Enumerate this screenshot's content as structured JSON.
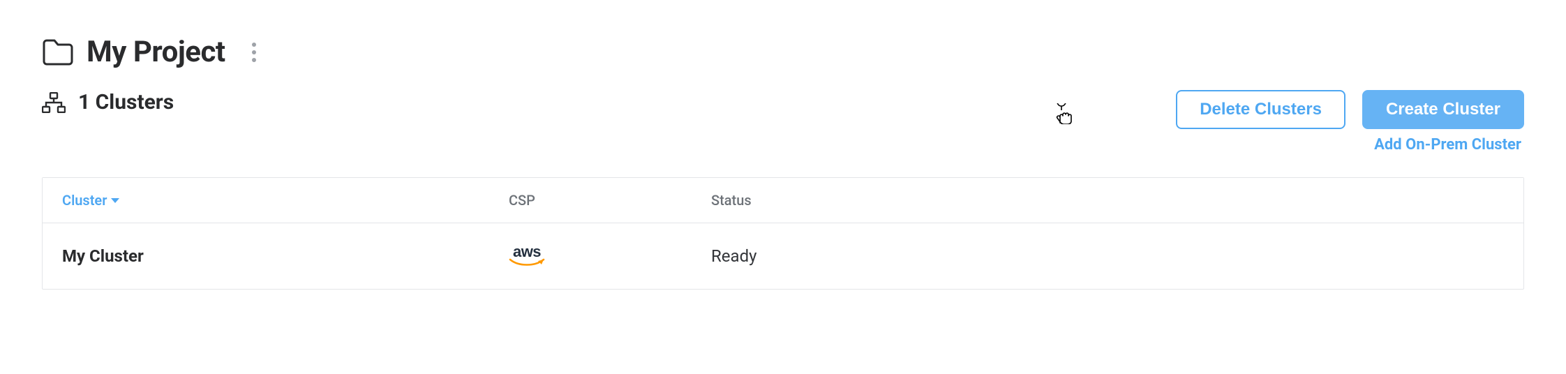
{
  "project": {
    "title": "My Project"
  },
  "subheader": {
    "clusters_label": "1 Clusters"
  },
  "actions": {
    "delete_label": "Delete Clusters",
    "create_label": "Create Cluster",
    "add_onprem_label": "Add On-Prem Cluster"
  },
  "table": {
    "columns": {
      "cluster": "Cluster",
      "csp": "CSP",
      "status": "Status"
    },
    "rows": [
      {
        "name": "My Cluster",
        "csp": "aws",
        "status": "Ready"
      }
    ]
  }
}
